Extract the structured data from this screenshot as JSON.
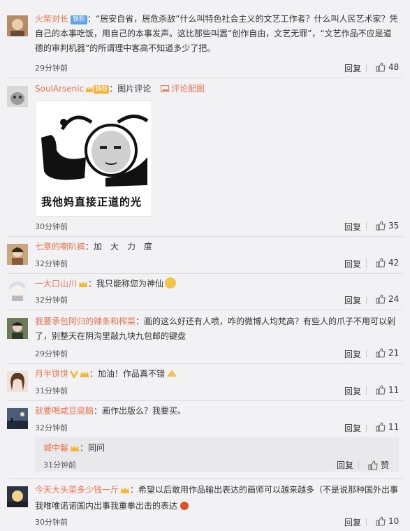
{
  "comments": [
    {
      "user": "火柴对长",
      "badge": "铁粉",
      "text": "：“居安自省，居危杀敌”什么叫特色社会主义的文艺工作者？什么叫人民艺术家？凭自己的本事吃饭，用自己的本事发声。这比那些叫嚣“创作自由，文艺无罪”，“文艺作品不应是道德的审判机器”的所谓理中客高不知道多少了把。",
      "time": "29分钟前",
      "reply": "回复",
      "likes": "48"
    },
    {
      "user": "SoulArsenic",
      "badge": "铁粉",
      "text": "：图片评论",
      "pic_link": "评论配图",
      "meme_caption": "我他妈直接正道的光",
      "time": "30分钟前",
      "reply": "回复",
      "likes": "35"
    },
    {
      "user": "七章的喇叭裤",
      "text": "：加　大　力　度",
      "time": "32分钟前",
      "reply": "回复",
      "likes": "42"
    },
    {
      "user": "一大口山川",
      "text": "：我只能称您为神仙",
      "time": "32分钟前",
      "reply": "回复",
      "likes": "24"
    },
    {
      "user": "我要承包阿归的辣条和榨菜",
      "text": "：画的这么好还有人喷，咋的微博人均梵高？有些人的爪子不用可以剁了，别整天在阴沟里敲九块九包邮的键盘",
      "time": "29分钟前",
      "reply": "回复",
      "likes": "21"
    },
    {
      "user": "月半饼饼",
      "text": "：加油！作品真不错",
      "time": "31分钟前",
      "reply": "回复",
      "likes": "11"
    },
    {
      "user": "就要喝咸豆腐脑",
      "text": "：画作出版么？我要买。",
      "time": "32分钟前",
      "reply": "回复",
      "likes": "11",
      "sub": {
        "user": "城中鬈",
        "text": "：同问",
        "time": "31分钟前",
        "reply": "回复",
        "likes": "赞"
      }
    },
    {
      "user": "今天大头菜多少钱一斤",
      "text": "：希望以后敢用作品输出表达的画师可以越来越多（不是说那种国外出事我唯唯诺诺国内出事我重拳出击的表达",
      "time": "30分钟前",
      "reply": "回复",
      "likes": "10"
    }
  ],
  "colors": {
    "username": "#eb7350",
    "background": "#f2f2f5",
    "separator": "#dcdcdc"
  }
}
